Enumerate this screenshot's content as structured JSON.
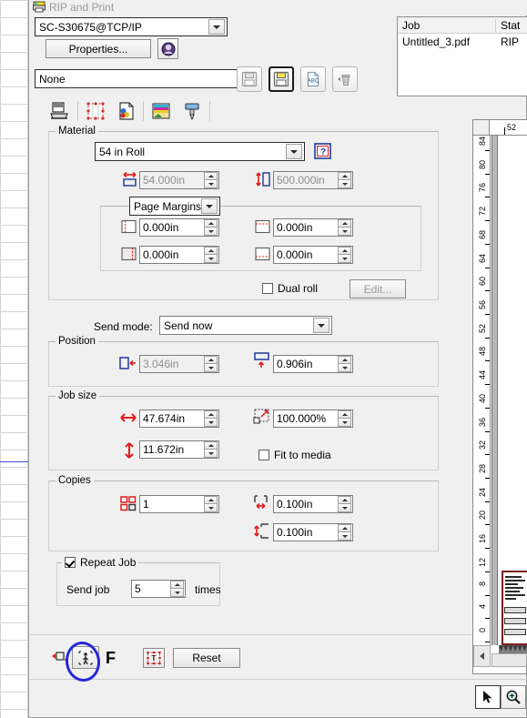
{
  "window": {
    "title": "RIP and Print",
    "icon": "printer-icon"
  },
  "printer": {
    "device_value": "SC-S30675@TCP/IP",
    "properties_label": "Properties...",
    "info_icon": "printer-info-icon"
  },
  "preset": {
    "value": "None",
    "save_icon": "save-disk-icon",
    "save_as_icon": "save-as-disk-icon",
    "rename_icon": "abc-rename-icon",
    "delete_icon": "trash-delete-icon"
  },
  "tabs": [
    {
      "name": "tab-print",
      "icon": "printer-page-icon",
      "selected": true
    },
    {
      "name": "tab-cut",
      "icon": "contour-cut-icon",
      "selected": false
    },
    {
      "name": "tab-color",
      "icon": "color-page-icon",
      "selected": false
    },
    {
      "name": "tab-layers",
      "icon": "color-bars-icon",
      "selected": false
    },
    {
      "name": "tab-nozzle",
      "icon": "print-head-icon",
      "selected": false
    }
  ],
  "joblist": {
    "columns": [
      "Job",
      "Stat"
    ],
    "rows": [
      {
        "job": "Untitled_3.pdf",
        "status": "RIP"
      }
    ]
  },
  "material": {
    "group_label": "Material",
    "roll_value": "54 in Roll",
    "help_icon": "media-help-icon",
    "width_icon": "media-width-icon",
    "width_value": "54.000in",
    "length_icon": "media-length-icon",
    "length_value": "500.000in",
    "margins_mode": "Page Margins",
    "margin_left_icon": "margin-left-icon",
    "margin_left": "0.000in",
    "margin_top_icon": "margin-top-icon",
    "margin_top": "0.000in",
    "margin_right_icon": "margin-right-icon",
    "margin_right": "0.000in",
    "margin_bottom_icon": "margin-bottom-icon",
    "margin_bottom": "0.000in",
    "dual_roll_label": "Dual roll",
    "dual_roll_checked": false,
    "edit_label": "Edit..."
  },
  "send": {
    "label": "Send mode:",
    "value": "Send now"
  },
  "position": {
    "group_label": "Position",
    "x_icon": "position-x-icon",
    "x_value": "3.046in",
    "y_icon": "position-y-icon",
    "y_value": "0.906in"
  },
  "jobsize": {
    "group_label": "Job size",
    "width_icon": "job-width-icon",
    "width_value": "47.674in",
    "height_icon": "job-height-icon",
    "height_value": "11.672in",
    "scale_icon": "job-scale-icon",
    "scale_value": "100.000%",
    "fit_label": "Fit to media",
    "fit_checked": false
  },
  "copies": {
    "group_label": "Copies",
    "count_icon": "copies-grid-icon",
    "count_value": "1",
    "hgap_icon": "horizontal-gap-icon",
    "hgap_value": "0.100in",
    "vgap_icon": "vertical-gap-icon",
    "vgap_value": "0.100in"
  },
  "repeat": {
    "group_label": "Repeat Job",
    "checked": true,
    "send_job_label": "Send job",
    "times_value": "5",
    "times_label": "times"
  },
  "bottombar": {
    "buttons": [
      {
        "name": "align-left-icon",
        "label": ""
      },
      {
        "name": "nest-person-icon",
        "label": "",
        "highlighted": true
      },
      {
        "name": "f-label",
        "label": "F"
      },
      {
        "name": "text-select-icon",
        "label": ""
      }
    ],
    "reset_label": "Reset"
  },
  "preview": {
    "h_ruler_tick": "52",
    "v_ruler_ticks": [
      "84",
      "80",
      "76",
      "72",
      "68",
      "64",
      "60",
      "56",
      "52",
      "48",
      "44",
      "40",
      "36",
      "32",
      "28",
      "24",
      "20",
      "16",
      "12",
      "8",
      "4",
      "0"
    ],
    "select_tool_icon": "arrow-select-icon",
    "zoom_tool_icon": "magnifier-zoom-icon"
  },
  "annotation": {
    "shape": "blue-circle-highlight",
    "color": "#2727d8"
  },
  "colors": {
    "accent_red": "#e01b1b",
    "dialog_bg": "#f0f0f0",
    "annotation_blue": "#2727d8"
  }
}
